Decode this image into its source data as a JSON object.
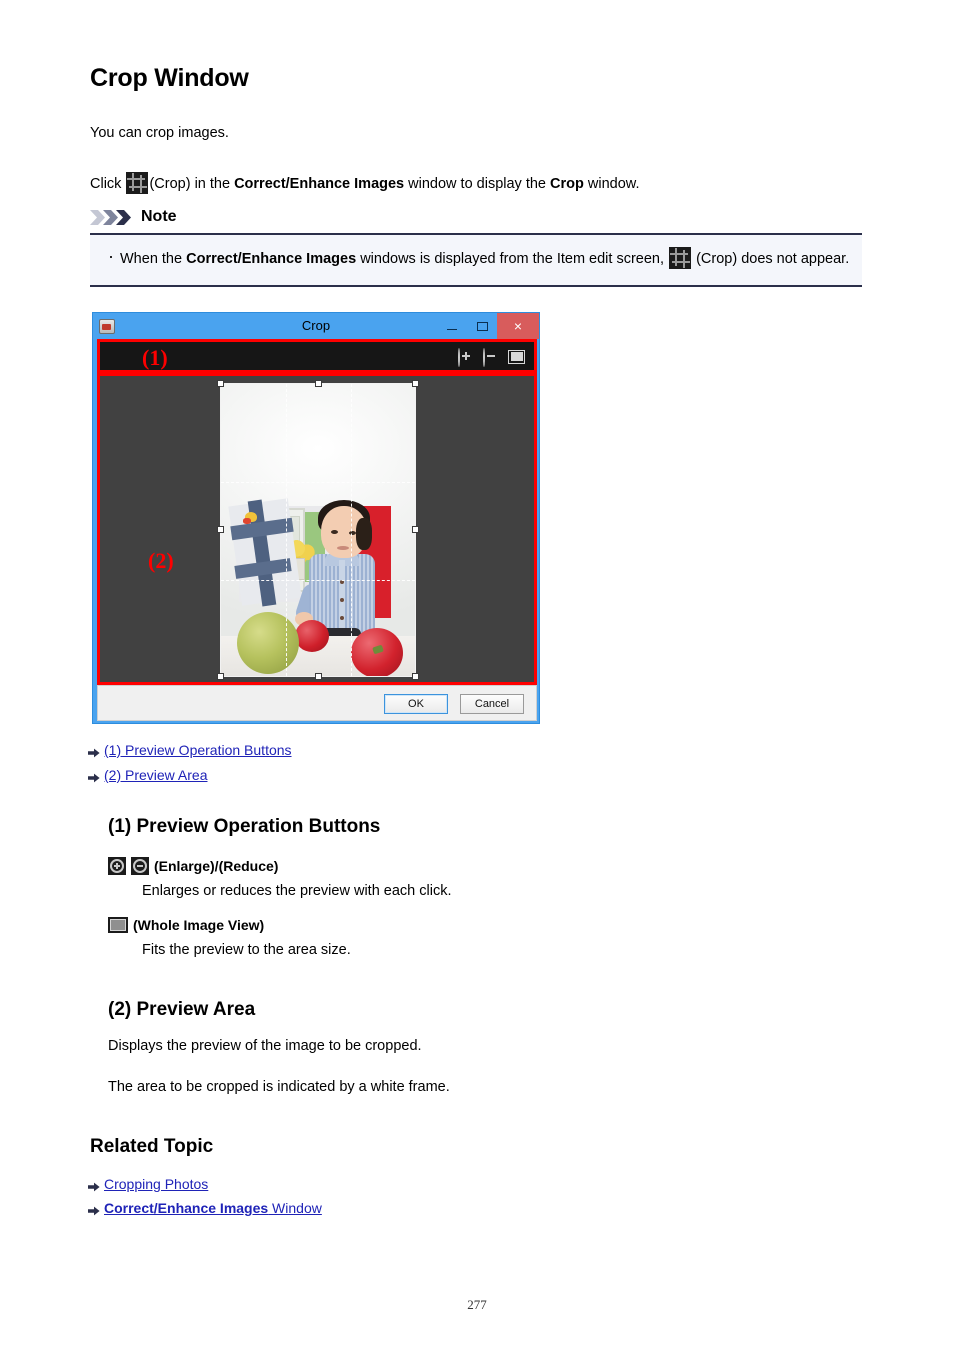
{
  "page": {
    "title": "Crop Window",
    "intro": "You can crop images.",
    "page_number": "277"
  },
  "click_line": {
    "prefix": "Click",
    "icon": "crop-icon",
    "after_icon": "(Crop) in the",
    "bold_1": "Correct/Enhance Images",
    "middle": "window to display the",
    "bold_2": "Crop",
    "suffix": "window."
  },
  "note": {
    "title": "Note",
    "item": {
      "prefix": "When the",
      "bold_1": "Correct/Enhance Images",
      "middle": "windows is displayed from the Item edit screen,",
      "icon": "crop-icon",
      "suffix": "(Crop) does not appear."
    }
  },
  "screenshot": {
    "window_title": "Crop",
    "app_icon": "app-icon",
    "window_buttons": {
      "minimize": "minimize-icon",
      "maximize": "maximize-icon",
      "close": "×"
    },
    "annotation_1": "(1)",
    "annotation_2": "(2)",
    "toolbar_icons": [
      {
        "name": "enlarge-icon",
        "label": "Enlarge"
      },
      {
        "name": "reduce-icon",
        "label": "Reduce"
      },
      {
        "name": "whole-image-view-icon",
        "label": "Whole Image View"
      }
    ],
    "buttons": {
      "ok": "OK",
      "cancel": "Cancel"
    }
  },
  "jump_links": [
    {
      "text": "(1) Preview Operation Buttons"
    },
    {
      "text": "(2) Preview Area"
    }
  ],
  "sections": {
    "preview_operation_buttons": {
      "heading": "(1) Preview Operation Buttons",
      "items": [
        {
          "icons": [
            "enlarge-icon",
            "reduce-icon"
          ],
          "label": "(Enlarge)/(Reduce)",
          "description": "Enlarges or reduces the preview with each click."
        },
        {
          "icons": [
            "whole-image-view-icon"
          ],
          "label": "(Whole Image View)",
          "description": "Fits the preview to the area size."
        }
      ]
    },
    "preview_area": {
      "heading": "(2) Preview Area",
      "paragraph_1": "Displays the preview of the image to be cropped.",
      "paragraph_2": "The area to be cropped is indicated by a white frame."
    },
    "related_topic": {
      "heading": "Related Topic",
      "links": [
        {
          "text": "Cropping Photos",
          "bold_part": "",
          "plain_part": "Cropping Photos"
        },
        {
          "text": "Correct/Enhance Images Window",
          "bold_part": "Correct/Enhance Images",
          "plain_part": " Window"
        }
      ]
    }
  },
  "colors": {
    "link": "#1f23b7",
    "annotation_red": "#fe0000",
    "note_rule": "#2b2f4a",
    "note_bg": "#f4f6fb",
    "titlebar": "#4aa3ef",
    "preview_bg": "#414141"
  }
}
